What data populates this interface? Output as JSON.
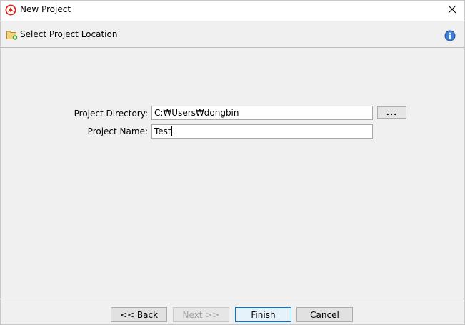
{
  "window": {
    "title": "New Project"
  },
  "header": {
    "title": "Select Project Location"
  },
  "form": {
    "directory_label": "Project Directory:",
    "directory_value": "C:₩Users₩dongbin",
    "browse_label": "...",
    "name_label": "Project Name:",
    "name_value": "Test"
  },
  "footer": {
    "back_label": "<< Back",
    "next_label": "Next >>",
    "finish_label": "Finish",
    "cancel_label": "Cancel"
  },
  "colors": {
    "panel_bg": "#f0f0f0",
    "default_button_border": "#0078d7",
    "app_icon_red": "#d9251c",
    "info_icon_blue": "#3f7fd6"
  },
  "icons": {
    "app": "app-logo-icon",
    "close": "close-icon",
    "folder": "folder-add-icon",
    "info": "info-icon"
  }
}
